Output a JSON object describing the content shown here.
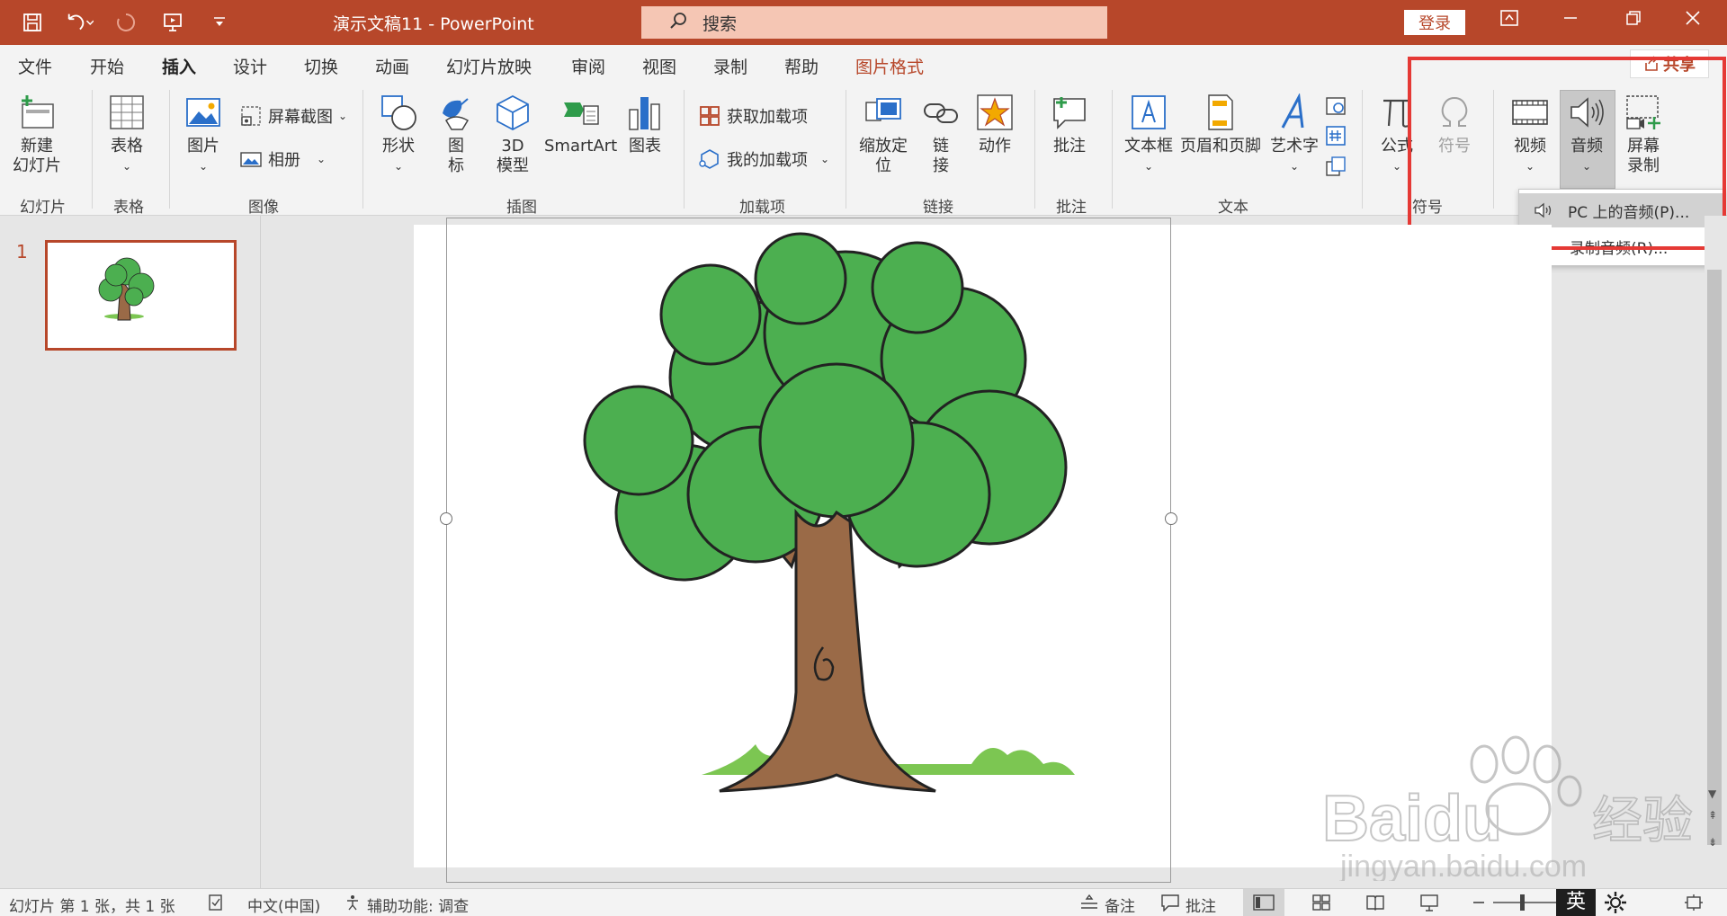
{
  "titlebar": {
    "doc_title": "演示文稿11  -  PowerPoint",
    "search_placeholder": "搜索",
    "login_label": "登录"
  },
  "tabs": [
    "文件",
    "开始",
    "插入",
    "设计",
    "切换",
    "动画",
    "幻灯片放映",
    "审阅",
    "视图",
    "录制",
    "帮助",
    "图片格式"
  ],
  "active_tab": "插入",
  "share_label": "共享",
  "ribbon": {
    "slides": {
      "new_slide": [
        "新建",
        "幻灯片"
      ],
      "group": "幻灯片"
    },
    "tables": {
      "table": "表格",
      "group": "表格"
    },
    "images": {
      "pictures": "图片",
      "screenshot": "屏幕截图",
      "album": "相册",
      "group": "图像"
    },
    "illustrations": {
      "shapes": "形状",
      "icons": [
        "图",
        "标"
      ],
      "models": [
        "3D",
        "模型"
      ],
      "smartart": "SmartArt",
      "chart": "图表",
      "group": "插图"
    },
    "addins": {
      "get": "获取加载项",
      "mine": "我的加载项",
      "group": "加载项"
    },
    "links": {
      "zoom": [
        "缩放定",
        "位"
      ],
      "link": [
        "链",
        "接"
      ],
      "action": "动作",
      "group": "链接"
    },
    "comments": {
      "comment": "批注",
      "group": "批注"
    },
    "text": {
      "textbox": "文本框",
      "header_footer": "页眉和页脚",
      "wordart": "艺术字",
      "group": "文本"
    },
    "symbols": {
      "equation": "公式",
      "symbol": "符号",
      "group": "符号"
    },
    "media": {
      "video": "视频",
      "audio": "音频",
      "screen_record": [
        "屏幕",
        "录制"
      ]
    }
  },
  "audio_menu": [
    "PC 上的音频(P)...",
    "录制音频(R)..."
  ],
  "thumbnail_number": "1",
  "statusbar": {
    "slide_info": "幻灯片 第 1 张，共 1 张",
    "language": "中文(中国)",
    "accessibility": "辅助功能: 调查",
    "notes": "备注",
    "comments": "批注",
    "ime": "英"
  },
  "watermark": {
    "brand": "Baidu",
    "cn": "经验",
    "url": "jingyan.baidu.com"
  },
  "colors": {
    "accent": "#b7472a",
    "highlight_box": "#e53935"
  }
}
